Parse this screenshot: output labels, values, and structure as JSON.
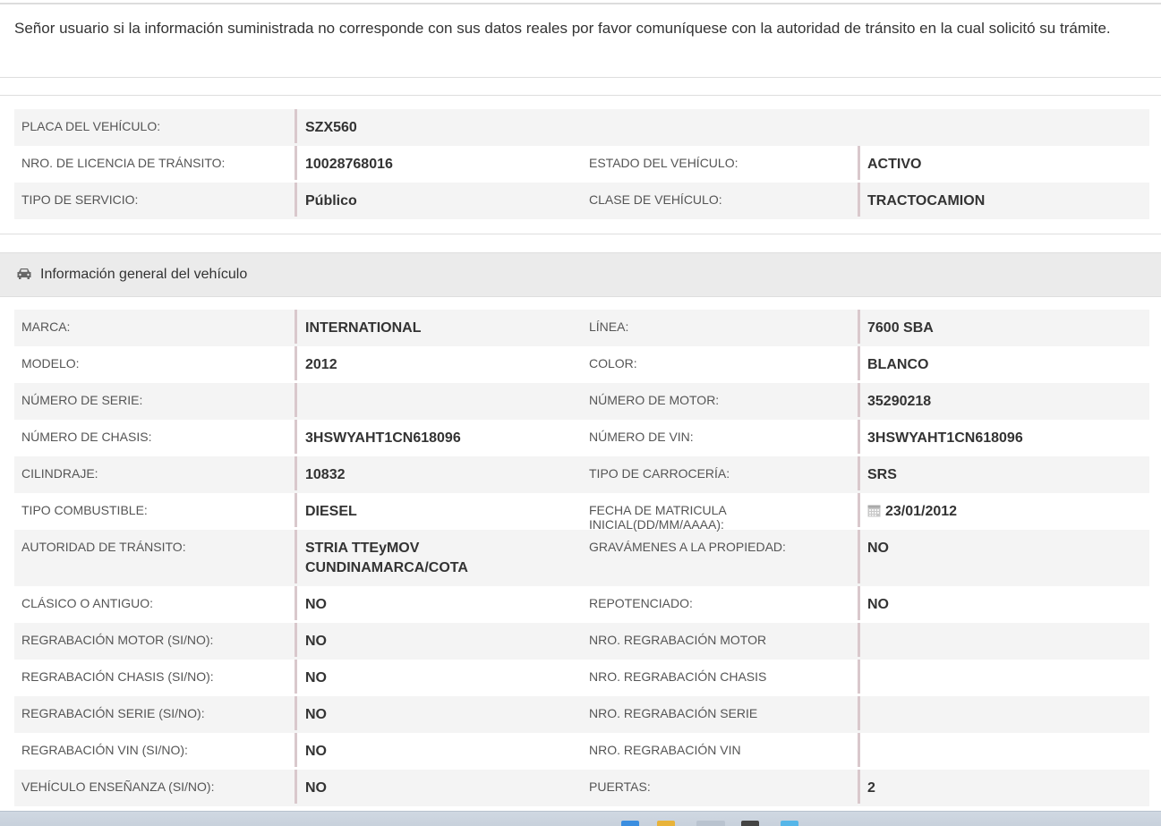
{
  "notice": "Señor usuario si la información suministrada no corresponde con sus datos reales por favor comuníquese con la autoridad de tránsito en la cual solicitó su trámite.",
  "summary": {
    "plate_label": "PLACA DEL VEHÍCULO:",
    "plate_value": "SZX560",
    "license_label": "NRO. DE LICENCIA DE TRÁNSITO:",
    "license_value": "10028768016",
    "status_label": "ESTADO DEL VEHÍCULO:",
    "status_value": "ACTIVO",
    "service_label": "TIPO DE SERVICIO:",
    "service_value": "Público",
    "class_label": "CLASE DE VEHÍCULO:",
    "class_value": "TRACTOCAMION"
  },
  "section": {
    "icon": "car-icon",
    "title": "Información general del vehículo"
  },
  "details": [
    {
      "l1": "MARCA:",
      "v1": "INTERNATIONAL",
      "l2": "LÍNEA:",
      "v2": "7600 SBA"
    },
    {
      "l1": "MODELO:",
      "v1": "2012",
      "l2": "COLOR:",
      "v2": "BLANCO"
    },
    {
      "l1": "NÚMERO DE SERIE:",
      "v1": "",
      "l2": "NÚMERO DE MOTOR:",
      "v2": "35290218"
    },
    {
      "l1": "NÚMERO DE CHASIS:",
      "v1": "3HSWYAHT1CN618096",
      "l2": "NÚMERO DE VIN:",
      "v2": "3HSWYAHT1CN618096"
    },
    {
      "l1": "CILINDRAJE:",
      "v1": "10832",
      "l2": "TIPO DE CARROCERÍA:",
      "v2": "SRS"
    },
    {
      "l1": "TIPO COMBUSTIBLE:",
      "v1": "DIESEL",
      "l2": "FECHA DE MATRICULA INICIAL(DD/MM/AAAA):",
      "v2": "23/01/2012"
    },
    {
      "l1": "AUTORIDAD DE TRÁNSITO:",
      "v1a": "STRIA TTEyMOV",
      "v1b": "CUNDINAMARCA/COTA",
      "l2": "GRAVÁMENES A LA PROPIEDAD:",
      "v2": "NO"
    },
    {
      "l1": "CLÁSICO O ANTIGUO:",
      "v1": "NO",
      "l2": "REPOTENCIADO:",
      "v2": "NO"
    },
    {
      "l1": "REGRABACIÓN MOTOR (SI/NO):",
      "v1": "NO",
      "l2": "NRO. REGRABACIÓN MOTOR",
      "v2": ""
    },
    {
      "l1": "REGRABACIÓN CHASIS (SI/NO):",
      "v1": "NO",
      "l2": "NRO. REGRABACIÓN CHASIS",
      "v2": ""
    },
    {
      "l1": "REGRABACIÓN SERIE (SI/NO):",
      "v1": "NO",
      "l2": "NRO. REGRABACIÓN SERIE",
      "v2": ""
    },
    {
      "l1": "REGRABACIÓN VIN (SI/NO):",
      "v1": "NO",
      "l2": "NRO. REGRABACIÓN VIN",
      "v2": ""
    },
    {
      "l1": "VEHÍCULO ENSEÑANZA (SI/NO):",
      "v1": "NO",
      "l2": "PUERTAS:",
      "v2": "2"
    }
  ],
  "colors": {
    "stripe": "#f4f4f4",
    "value_border": "#d9c8cc",
    "section_bg": "#ebebeb"
  }
}
